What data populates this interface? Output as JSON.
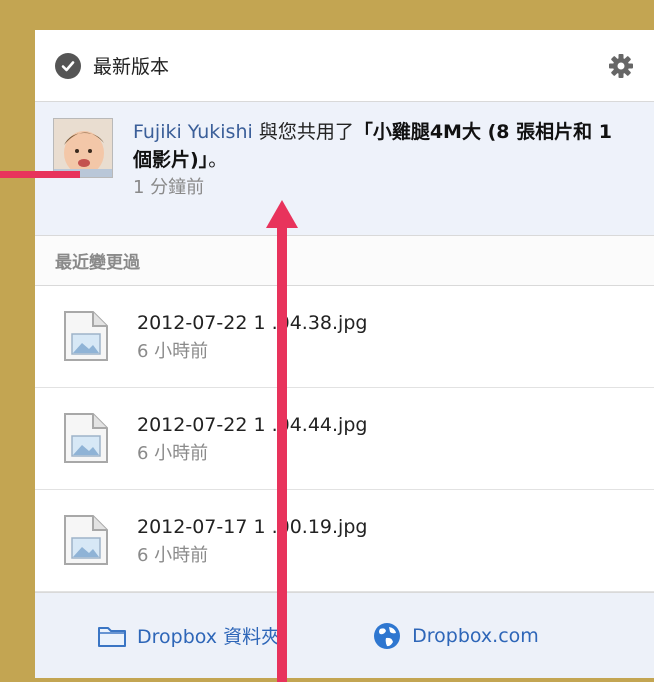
{
  "header": {
    "title": "最新版本",
    "status_icon": "check-circle-icon",
    "settings_icon": "gear-icon"
  },
  "notification": {
    "sender": "Fujiki Yukishi",
    "action_text": " 與您共用了",
    "shared_item": "「小雞腿4M大 (8 張相片和 1 個影片)」",
    "end_text": "。",
    "time": "1 分鐘前"
  },
  "recent": {
    "label": "最近變更過",
    "files": [
      {
        "name": "2012-07-22 1 .04.38.jpg",
        "time": "6 小時前"
      },
      {
        "name": "2012-07-22 1 .04.44.jpg",
        "time": "6 小時前"
      },
      {
        "name": "2012-07-17 1 .00.19.jpg",
        "time": "6 小時前"
      }
    ]
  },
  "footer": {
    "folder_link": "Dropbox 資料夾",
    "web_link": "Dropbox.com"
  },
  "colors": {
    "frame": "#c3a552",
    "annotation_arrow": "#e8335c",
    "link": "#2e66b8"
  }
}
